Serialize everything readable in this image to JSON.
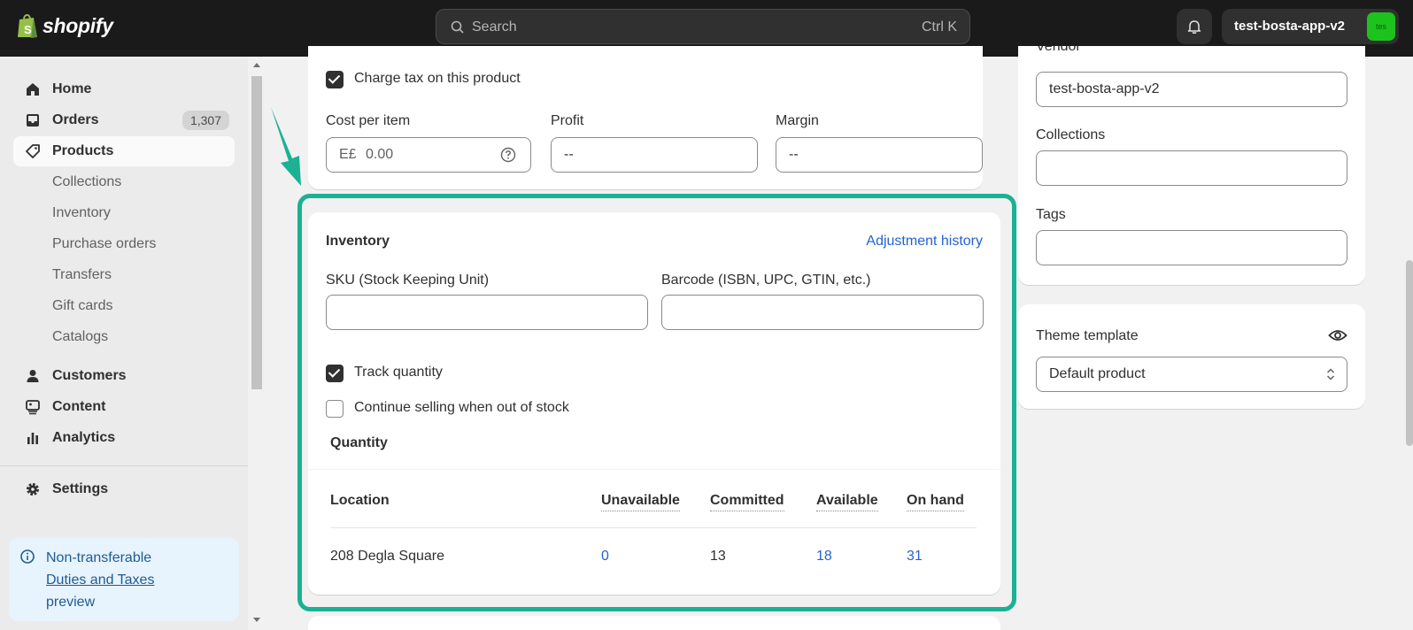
{
  "topbar": {
    "logo_text": "shopify",
    "search_placeholder": "Search",
    "search_shortcut": "Ctrl K",
    "store_name": "test-bosta-app-v2",
    "store_avatar": "tes"
  },
  "sidebar": {
    "items": [
      {
        "label": "Home",
        "icon": "home-icon"
      },
      {
        "label": "Orders",
        "icon": "inbox-icon",
        "badge": "1,307"
      },
      {
        "label": "Products",
        "icon": "tag-icon",
        "active": true
      },
      {
        "label": "Collections"
      },
      {
        "label": "Inventory"
      },
      {
        "label": "Purchase orders"
      },
      {
        "label": "Transfers"
      },
      {
        "label": "Gift cards"
      },
      {
        "label": "Catalogs"
      },
      {
        "label": "Customers",
        "icon": "person-icon"
      },
      {
        "label": "Content",
        "icon": "content-icon"
      },
      {
        "label": "Analytics",
        "icon": "bar-chart-icon"
      }
    ],
    "settings_label": "Settings",
    "notice": {
      "line1": "Non-transferable",
      "link": "Duties and Taxes",
      "line3": "preview"
    }
  },
  "pricing": {
    "charge_tax_label": "Charge tax on this product",
    "charge_tax_checked": true,
    "cost_label": "Cost per item",
    "cost_prefix": "E£",
    "cost_value": "0.00",
    "profit_label": "Profit",
    "profit_value": "--",
    "margin_label": "Margin",
    "margin_value": "--"
  },
  "inventory": {
    "title": "Inventory",
    "adjustment_link": "Adjustment history",
    "sku_label": "SKU (Stock Keeping Unit)",
    "sku_value": "",
    "barcode_label": "Barcode (ISBN, UPC, GTIN, etc.)",
    "barcode_value": "",
    "track_quantity_label": "Track quantity",
    "track_quantity_checked": true,
    "continue_selling_label": "Continue selling when out of stock",
    "continue_selling_checked": false,
    "quantity_title": "Quantity",
    "table": {
      "headers": [
        "Location",
        "Unavailable",
        "Committed",
        "Available",
        "On hand"
      ],
      "rows": [
        {
          "location": "208 Degla Square",
          "unavailable": "0",
          "committed": "13",
          "available": "18",
          "on_hand": "31"
        }
      ]
    }
  },
  "organization": {
    "vendor_label": "Vendor",
    "vendor_value": "test-bosta-app-v2",
    "collections_label": "Collections",
    "tags_label": "Tags"
  },
  "theme": {
    "label": "Theme template",
    "value": "Default product"
  },
  "colors": {
    "highlight": "#1bb193",
    "link": "#2463d1",
    "topbar": "#1a1a1a"
  }
}
